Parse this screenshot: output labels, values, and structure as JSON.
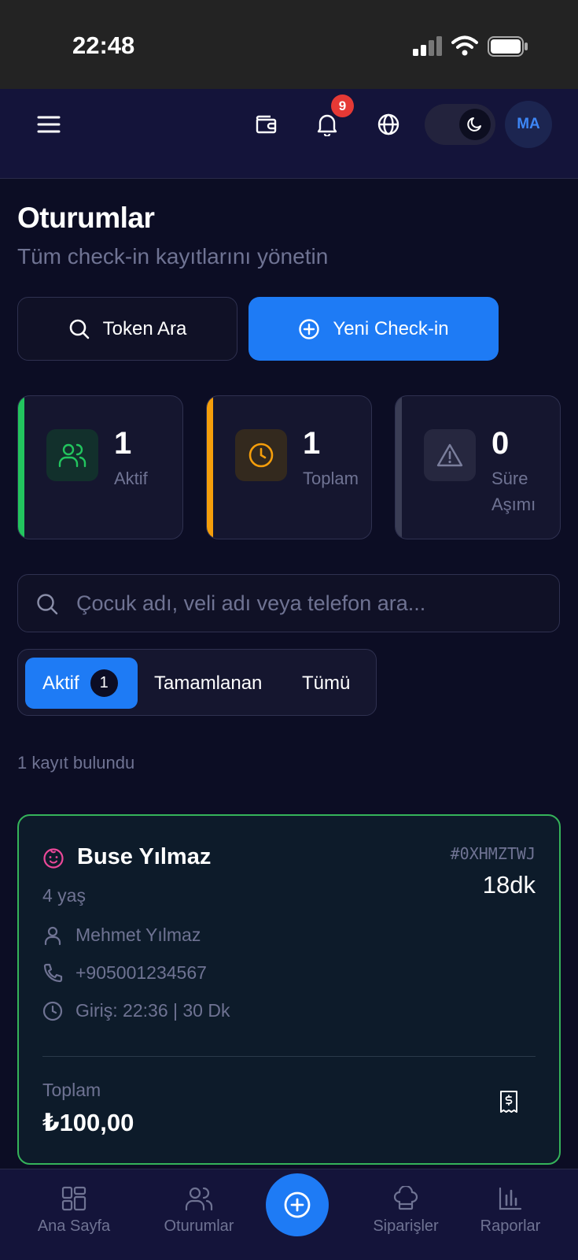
{
  "status_bar": {
    "time": "22:48"
  },
  "header": {
    "notification_count": "9",
    "avatar_initials": "MA"
  },
  "page": {
    "title": "Oturumlar",
    "subtitle": "Tüm check-in kayıtlarını yönetin"
  },
  "actions": {
    "token_search_label": "Token Ara",
    "new_checkin_label": "Yeni Check-in"
  },
  "stats": [
    {
      "value": "1",
      "label": "Aktif",
      "color": "#22c55e",
      "icon": "users-icon"
    },
    {
      "value": "1",
      "label": "Toplam",
      "color": "#f59e0b",
      "icon": "clock-icon"
    },
    {
      "value": "0",
      "label": "Süre Aşımı",
      "color": "#3a3d55",
      "icon": "warning-icon"
    }
  ],
  "search": {
    "placeholder": "Çocuk adı, veli adı veya telefon ara..."
  },
  "tabs": {
    "active_label": "Aktif",
    "active_count": "1",
    "completed_label": "Tamamlanan",
    "all_label": "Tümü"
  },
  "results": {
    "count_text": "1 kayıt bulundu"
  },
  "session_card": {
    "child_name": "Buse Yılmaz",
    "age": "4 yaş",
    "token": "#0XHMZTWJ",
    "duration": "18dk",
    "parent_name": "Mehmet Yılmaz",
    "phone": "+905001234567",
    "checkin": "Giriş: 22:36 | 30 Dk",
    "total_label": "Toplam",
    "total_value": "₺100,00",
    "border_color": "#35b35a"
  },
  "bottom_nav": {
    "home": "Ana Sayfa",
    "sessions": "Oturumlar",
    "orders": "Siparişler",
    "reports": "Raporlar"
  },
  "colors": {
    "background": "#0c0d24",
    "accent": "#1e7bf5",
    "muted_text": "#6f7393"
  }
}
